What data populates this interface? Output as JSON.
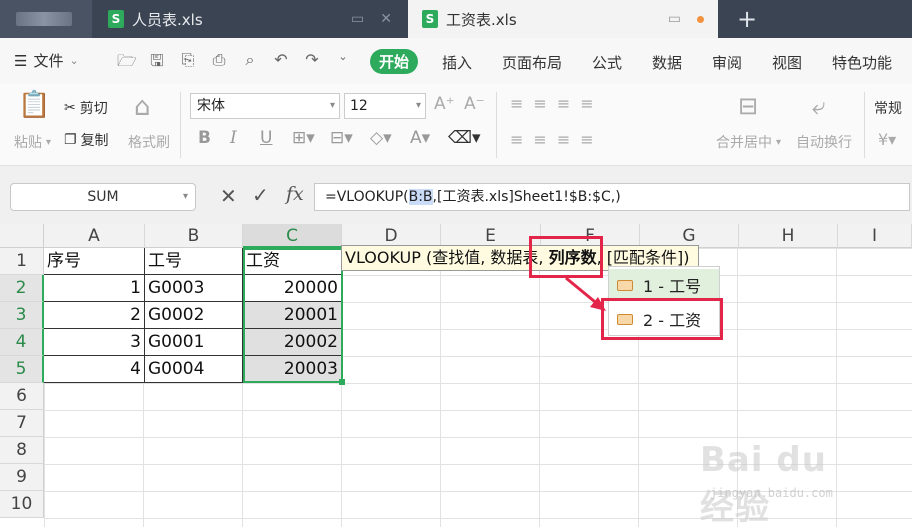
{
  "tabs": {
    "tab1": {
      "label": "人员表.xls"
    },
    "tab2": {
      "label": "工资表.xls"
    },
    "new_tab": "+"
  },
  "menu": {
    "file": "文件",
    "start": "开始",
    "items": [
      "插入",
      "页面布局",
      "公式",
      "数据",
      "审阅",
      "视图",
      "特色功能"
    ]
  },
  "ribbon": {
    "paste": "粘贴",
    "cut": "剪切",
    "copy": "复制",
    "format_painter": "格式刷",
    "font_name": "宋体",
    "font_size": "12",
    "merge_center": "合并居中",
    "wrap_text": "自动换行",
    "number_format": "常规"
  },
  "formula_bar": {
    "name_box": "SUM",
    "fx": "fx",
    "formula_prefix": "=VLOOKUP(",
    "formula_highlight": "B:B",
    "formula_suffix": ",[工资表.xls]Sheet1!$B:$C,)"
  },
  "columns": [
    "A",
    "B",
    "C",
    "D",
    "E",
    "F",
    "G",
    "H",
    "I"
  ],
  "rows": [
    "1",
    "2",
    "3",
    "4",
    "5",
    "6",
    "7",
    "8",
    "9",
    "10"
  ],
  "table": {
    "headers": [
      "序号",
      "工号",
      "工资"
    ],
    "rows": [
      [
        "1",
        "G0003",
        "20000"
      ],
      [
        "2",
        "G0002",
        "20001"
      ],
      [
        "3",
        "G0001",
        "20002"
      ],
      [
        "4",
        "G0004",
        "20003"
      ]
    ]
  },
  "tooltip": {
    "prefix": "VLOOKUP (查找值, 数据表, ",
    "bold": "列序数",
    "suffix": ", [匹配条件])"
  },
  "suggestions": [
    "1 - 工号",
    "2 - 工资"
  ],
  "watermark": {
    "title": "Bai du 经验",
    "sub": "jingyan.baidu.com"
  },
  "colors": {
    "accent": "#2eaa5d",
    "annotation_red": "#e4254a",
    "tab_bar": "#3b4452"
  }
}
